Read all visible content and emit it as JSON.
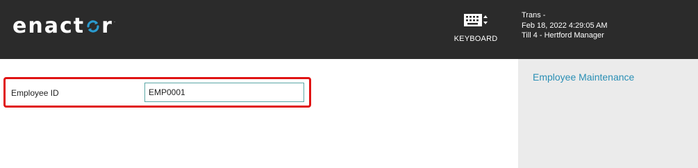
{
  "header": {
    "logo_text_start": "enact",
    "logo_text_end": "r",
    "logo_trademark": ".",
    "keyboard_label": "KEYBOARD",
    "icon_keyboard": "keyboard-icon",
    "status": {
      "transaction": "Trans -",
      "datetime": "Feb 18, 2022 4:29:05 AM",
      "terminal": "Till 4 - Hertford Manager"
    }
  },
  "form": {
    "employee_id_label": "Employee ID",
    "employee_id_value": "EMP0001"
  },
  "sidebar": {
    "link_label": "Employee Maintenance"
  },
  "colors": {
    "header_bg": "#2b2b2b",
    "highlight_border": "#e01313",
    "link": "#2a8fb5",
    "input_border": "#5ba7a6",
    "logo_accent": "#2a9bd0"
  }
}
